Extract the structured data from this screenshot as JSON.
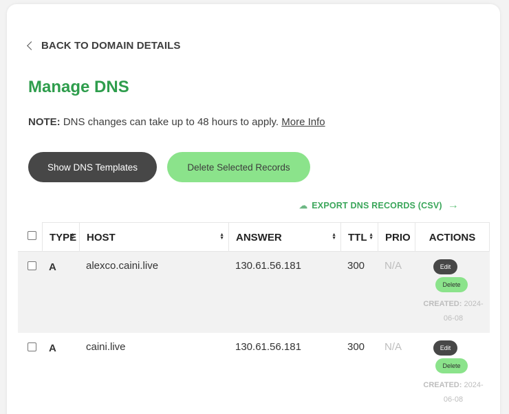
{
  "nav": {
    "back_label": "BACK TO DOMAIN DETAILS"
  },
  "page": {
    "title": "Manage DNS"
  },
  "note": {
    "label": "NOTE:",
    "text": " DNS changes can take up to 48 hours to apply. ",
    "link": "More Info"
  },
  "buttons": {
    "templates": "Show DNS Templates",
    "delete_selected": "Delete Selected Records"
  },
  "export": {
    "label": "EXPORT DNS RECORDS (CSV)"
  },
  "table": {
    "headers": {
      "type": "TYPE",
      "host": "HOST",
      "answer": "ANSWER",
      "ttl": "TTL",
      "prio": "PRIO",
      "actions": "ACTIONS"
    },
    "rows": [
      {
        "type": "A",
        "host": "alexco.caini.live",
        "answer": "130.61.56.181",
        "ttl": "300",
        "prio": "N/A",
        "edit": "Edit",
        "delete": "Delete",
        "created_label": "CREATED:",
        "created_date": "2024-06-08"
      },
      {
        "type": "A",
        "host": "caini.live",
        "answer": "130.61.56.181",
        "ttl": "300",
        "prio": "N/A",
        "edit": "Edit",
        "delete": "Delete",
        "created_label": "CREATED:",
        "created_date": "2024-06-08"
      }
    ]
  },
  "colors": {
    "accent_green": "#2e9d4c",
    "button_green": "#8be38b",
    "button_dark": "#474747"
  }
}
